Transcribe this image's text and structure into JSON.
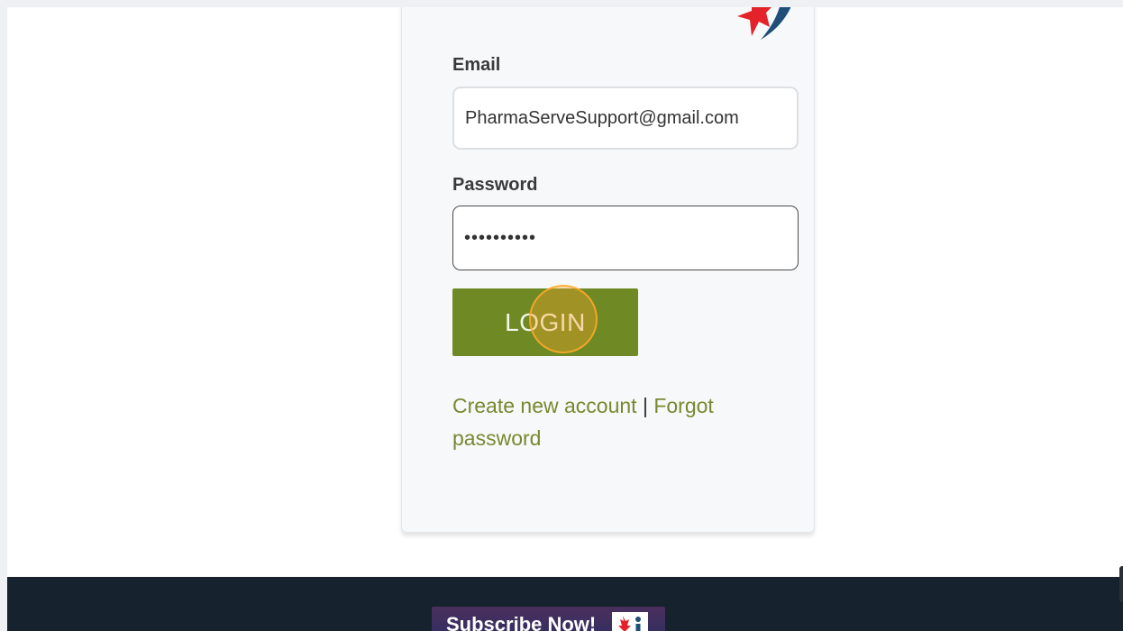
{
  "form": {
    "email_label": "Email",
    "email_value": "PharmaServeSupport@gmail.com",
    "password_label": "Password",
    "password_value": "••••••••••",
    "login_label": "LOGIN"
  },
  "links": {
    "create_account": "Create new account",
    "separator": " | ",
    "forgot_password": "Forgot password"
  },
  "footer": {
    "subscribe_label": "Subscribe Now!"
  },
  "icons": {
    "brand_logo": "maple-leaf-logo-icon",
    "subscribe_icon": "maple-leaf-icon"
  },
  "colors": {
    "login_button": "#6f8a24",
    "link": "#76892f",
    "footer": "#16222d",
    "logo_red": "#e3222a",
    "logo_blue": "#1f4e79"
  }
}
